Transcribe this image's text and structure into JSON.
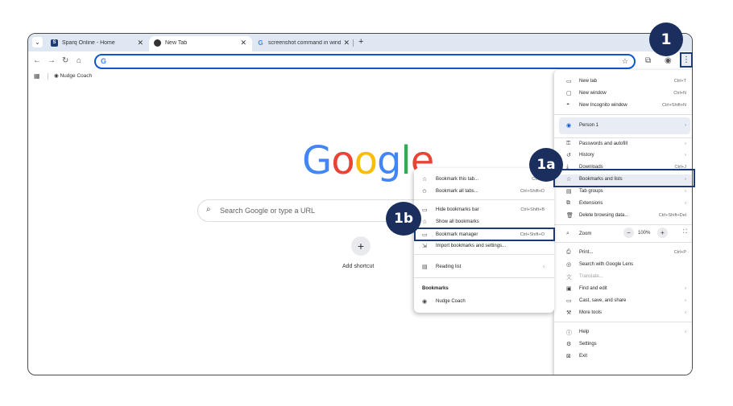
{
  "browser": {
    "tabs": [
      {
        "title": "Sparq Online - Home",
        "favicon": "S",
        "color": "#1a3a78"
      },
      {
        "title": "New Tab",
        "favicon": "chrome-icon",
        "color": "#333333"
      },
      {
        "title": "screenshot command in windo",
        "favicon": "G",
        "color": "#4285f4"
      }
    ],
    "omnibox_value": "",
    "bookmarks_bar": {
      "item": "Nudge Coach"
    }
  },
  "new_tab_page": {
    "logo_letters": [
      "G",
      "o",
      "o",
      "g",
      "l",
      "e"
    ],
    "logo_colors": [
      "#4285f4",
      "#ea4335",
      "#fbbc05",
      "#4285f4",
      "#34a853",
      "#ea4335"
    ],
    "search_placeholder": "Search Google or type a URL",
    "add_shortcut_label": "Add shortcut"
  },
  "main_menu": {
    "new_tab": {
      "label": "New tab",
      "shortcut": "Ctrl+T"
    },
    "new_window": {
      "label": "New window",
      "shortcut": "Ctrl+N"
    },
    "new_incognito": {
      "label": "New Incognito window",
      "shortcut": "Ctrl+Shift+N"
    },
    "person": {
      "label": "Person 1"
    },
    "passwords": {
      "label": "Passwords and autofill"
    },
    "history": {
      "label": "History"
    },
    "downloads": {
      "label": "Downloads",
      "shortcut": "Ctrl+J"
    },
    "bookmarks_lists": {
      "label": "Bookmarks and lists"
    },
    "tab_groups": {
      "label": "Tab groups"
    },
    "extensions": {
      "label": "Extensions"
    },
    "delete_data": {
      "label": "Delete browsing data...",
      "shortcut": "Ctrl+Shift+Del"
    },
    "zoom": {
      "label": "Zoom",
      "value": "100%"
    },
    "print": {
      "label": "Print...",
      "shortcut": "Ctrl+P"
    },
    "lens": {
      "label": "Search with Google Lens"
    },
    "translate": {
      "label": "Translate..."
    },
    "find_edit": {
      "label": "Find and edit"
    },
    "cast_save": {
      "label": "Cast, save, and share"
    },
    "more_tools": {
      "label": "More tools"
    },
    "help": {
      "label": "Help"
    },
    "settings": {
      "label": "Settings"
    },
    "exit": {
      "label": "Exit"
    }
  },
  "sub_menu": {
    "bookmark_tab": {
      "label": "Bookmark this tab...",
      "shortcut": "Ctrl+D"
    },
    "bookmark_all": {
      "label": "Bookmark all tabs...",
      "shortcut": "Ctrl+Shift+D"
    },
    "hide_bar": {
      "label": "Hide bookmarks bar",
      "shortcut": "Ctrl+Shift+B"
    },
    "show_all": {
      "label": "Show all bookmarks"
    },
    "manager": {
      "label": "Bookmark manager",
      "shortcut": "Ctrl+Shift+O"
    },
    "import": {
      "label": "Import bookmarks and settings..."
    },
    "reading_list": {
      "label": "Reading list"
    },
    "heading": "Bookmarks",
    "nudge": {
      "label": "Nudge Coach"
    }
  },
  "callouts": {
    "step1": "1",
    "step1a": "1a",
    "step1b": "1b"
  }
}
